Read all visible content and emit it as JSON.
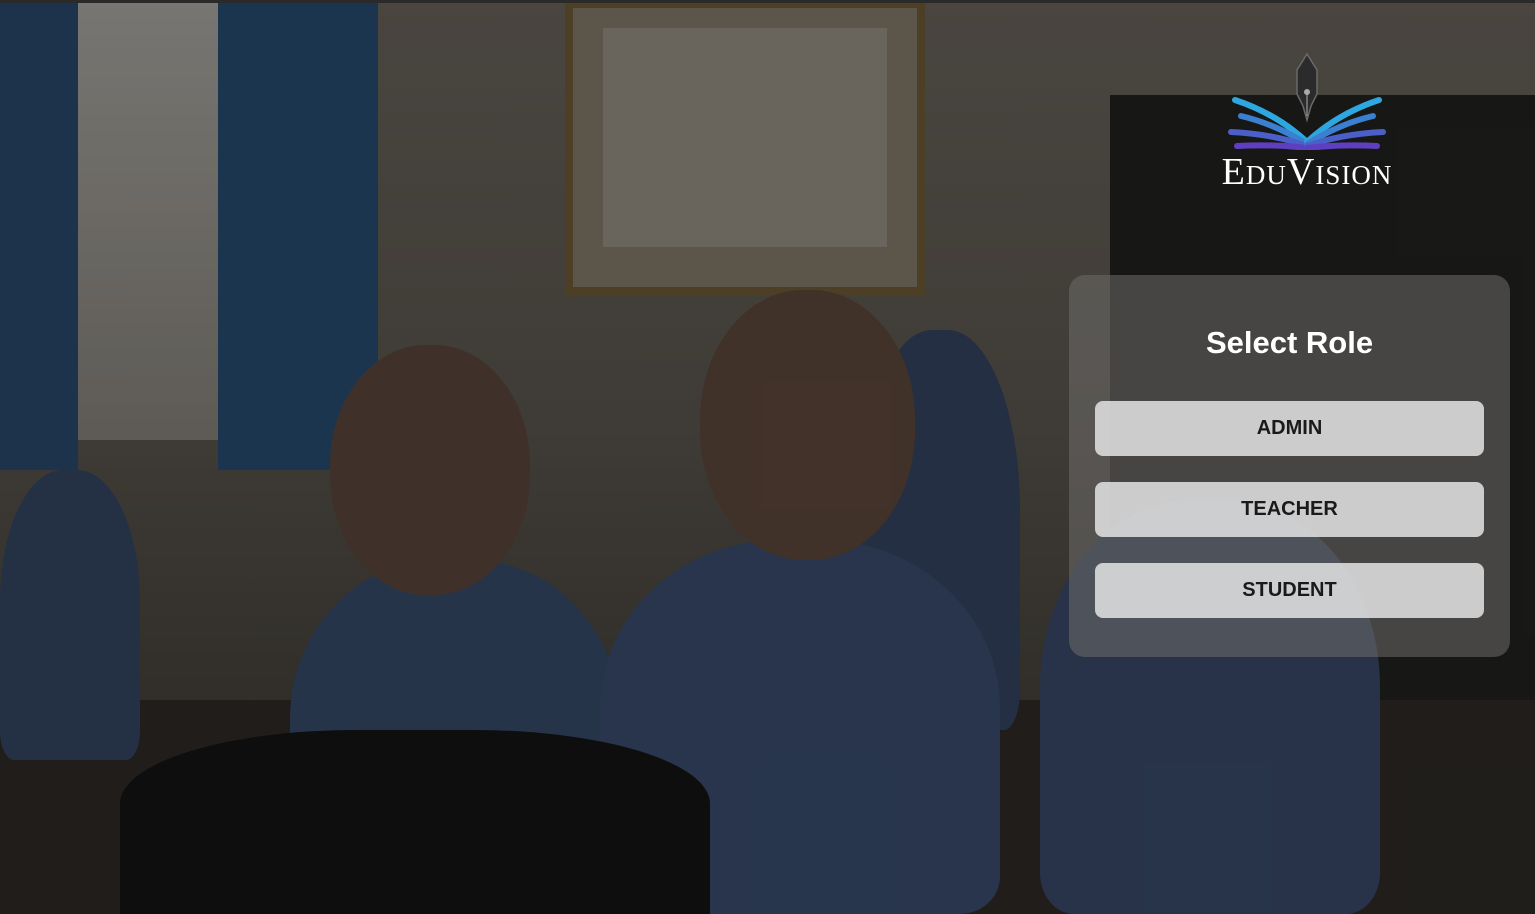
{
  "brand": {
    "name": "EduVision",
    "logo_icon": "pen-book-icon",
    "colors": {
      "accent_blue": "#2d9fd9",
      "accent_purple": "#5b3fbf",
      "text": "#ffffff"
    }
  },
  "role_panel": {
    "title": "Select Role",
    "buttons": [
      {
        "label": "ADMIN"
      },
      {
        "label": "TEACHER"
      },
      {
        "label": "STUDENT"
      }
    ]
  }
}
